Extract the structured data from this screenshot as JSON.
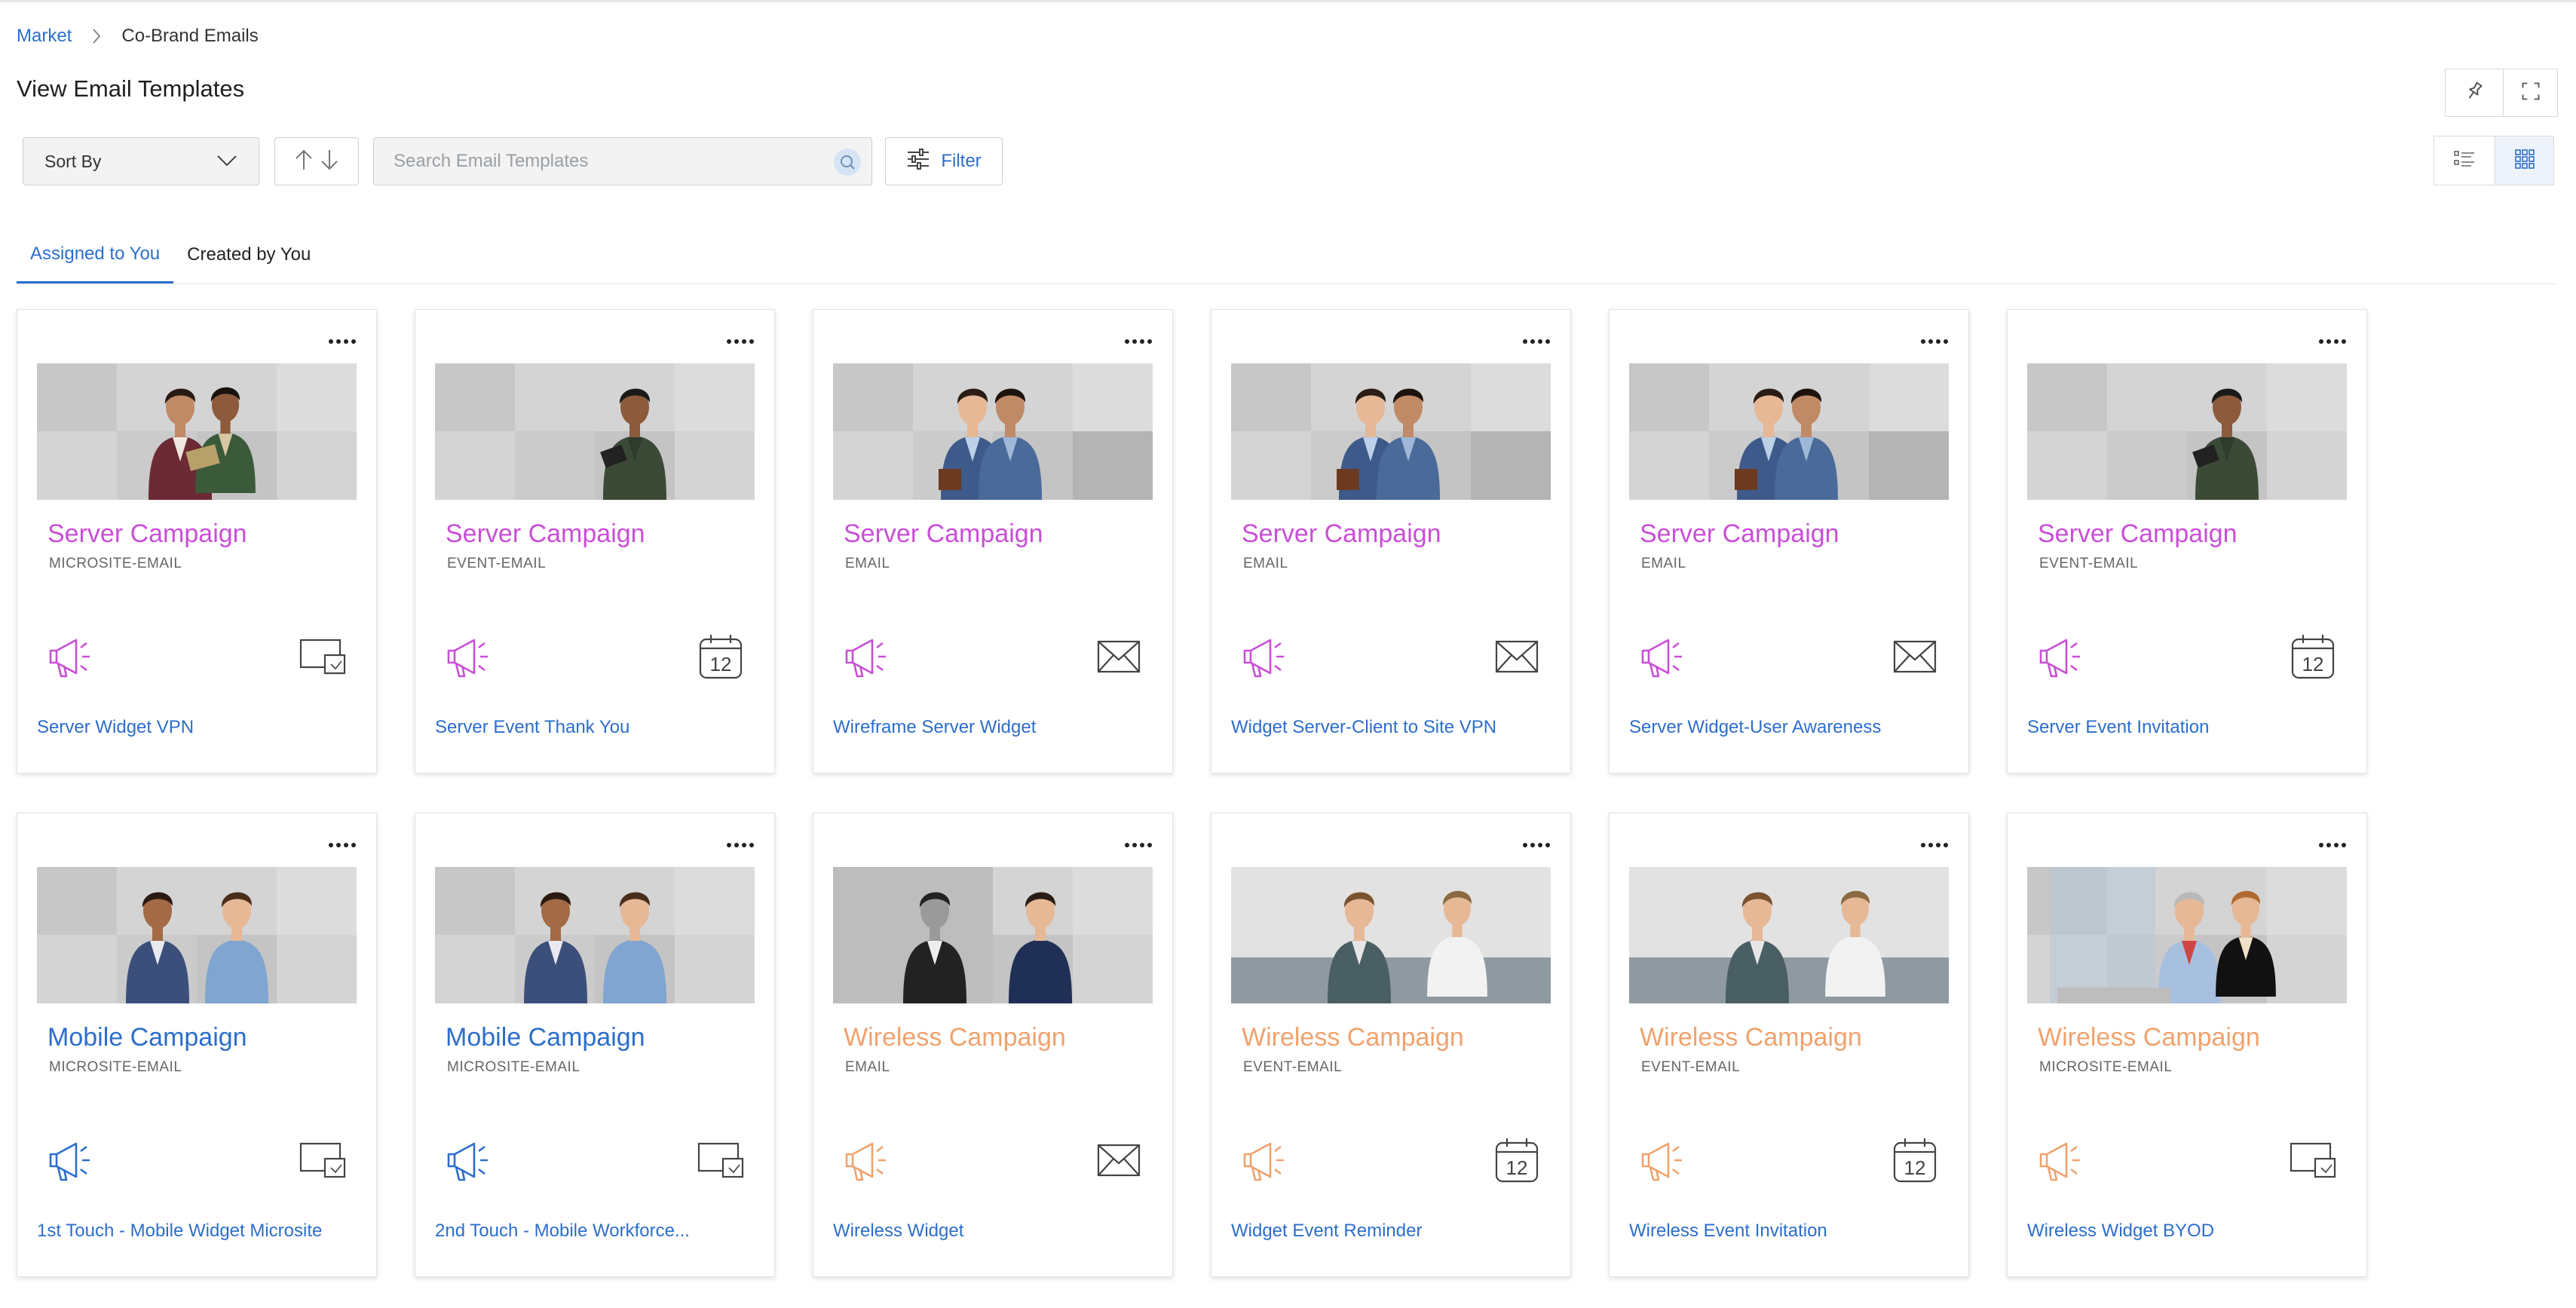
{
  "breadcrumb": {
    "root": "Market",
    "current": "Co-Brand Emails"
  },
  "page": {
    "title": "View Email Templates"
  },
  "toolbar": {
    "sort_label": "Sort By",
    "search_placeholder": "Search Email Templates",
    "filter_label": "Filter"
  },
  "tabs": [
    {
      "label": "Assigned to You",
      "active": true
    },
    {
      "label": "Created by You",
      "active": false
    }
  ],
  "colors": {
    "accent": "#2c6ecb",
    "server": "#c84fd6",
    "mobile": "#2c6ecb",
    "wireless": "#f0a26d"
  },
  "cards": [
    {
      "campaign": "Server Campaign",
      "type": "MICROSITE-EMAIL",
      "name": "Server Widget VPN",
      "theme": "server",
      "icon": "microsite-icon",
      "photo": "couple-tablet"
    },
    {
      "campaign": "Server Campaign",
      "type": "EVENT-EMAIL",
      "name": "Server Event Thank You",
      "theme": "server",
      "icon": "calendar-icon",
      "photo": "man-tablet"
    },
    {
      "campaign": "Server Campaign",
      "type": "EMAIL",
      "name": "Wireframe Server Widget",
      "theme": "server",
      "icon": "envelope-icon",
      "photo": "two-men-walking"
    },
    {
      "campaign": "Server Campaign",
      "type": "EMAIL",
      "name": "Widget Server-Client to Site VPN",
      "theme": "server",
      "icon": "envelope-icon",
      "photo": "two-men-walking"
    },
    {
      "campaign": "Server Campaign",
      "type": "EMAIL",
      "name": "Server Widget-User Awareness",
      "theme": "server",
      "icon": "envelope-icon",
      "photo": "two-men-walking"
    },
    {
      "campaign": "Server Campaign",
      "type": "EVENT-EMAIL",
      "name": "Server Event Invitation",
      "theme": "server",
      "icon": "calendar-icon",
      "photo": "man-tablet"
    },
    {
      "campaign": "Mobile Campaign",
      "type": "MICROSITE-EMAIL",
      "name": "1st Touch - Mobile Widget Microsite",
      "theme": "mobile",
      "icon": "microsite-icon",
      "photo": "couple-phones"
    },
    {
      "campaign": "Mobile Campaign",
      "type": "MICROSITE-EMAIL",
      "name": "2nd Touch - Mobile Workforce...",
      "theme": "mobile",
      "icon": "microsite-icon",
      "photo": "couple-phones"
    },
    {
      "campaign": "Wireless Campaign",
      "type": "EMAIL",
      "name": "Wireless Widget",
      "theme": "wireless",
      "icon": "envelope-icon",
      "photo": "two-men-phones"
    },
    {
      "campaign": "Wireless Campaign",
      "type": "EVENT-EMAIL",
      "name": "Widget Event Reminder",
      "theme": "wireless",
      "icon": "calendar-icon",
      "photo": "meeting-sofa"
    },
    {
      "campaign": "Wireless Campaign",
      "type": "EVENT-EMAIL",
      "name": "Wireless Event Invitation",
      "theme": "wireless",
      "icon": "calendar-icon",
      "photo": "meeting-sofa"
    },
    {
      "campaign": "Wireless Campaign",
      "type": "MICROSITE-EMAIL",
      "name": "Wireless Widget BYOD",
      "theme": "wireless",
      "icon": "microsite-icon",
      "photo": "office-laptop"
    }
  ],
  "calendar_day": "12"
}
